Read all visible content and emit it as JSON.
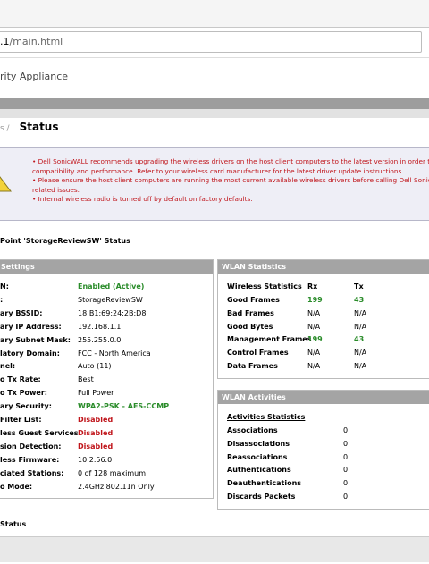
{
  "browser": {
    "url_prefix": ".1",
    "url_path": "/main.html"
  },
  "header": {
    "app_title": "rity Appliance"
  },
  "breadcrumb": {
    "prev": "s /",
    "current": "Status"
  },
  "warnings": [
    "• Dell SonicWALL recommends upgrading the wireless drivers on the host client computers to the latest version in order to",
    "compatibility and performance. Refer to your wireless card manufacturer for the latest driver update instructions.",
    "• Please ensure the host client computers are running the most current available wireless drivers before calling Dell SonicW",
    "related issues.",
    "• Internal wireless radio is turned off by default on factory defaults."
  ],
  "ap_status_title": "Point 'StorageReviewSW' Status",
  "settings": {
    "header": "Settings",
    "rows": [
      {
        "label": "N:",
        "value": "Enabled (Active)",
        "style": "green"
      },
      {
        "label": ":",
        "value": "StorageReviewSW",
        "style": ""
      },
      {
        "label": "ary BSSID:",
        "value": "18:B1:69:24:2B:D8",
        "style": ""
      },
      {
        "label": "ary IP Address:",
        "value": "192.168.1.1",
        "style": ""
      },
      {
        "label": "ary Subnet Mask:",
        "value": "255.255.0.0",
        "style": ""
      },
      {
        "label": "latory Domain:",
        "value": "FCC - North America",
        "style": ""
      },
      {
        "label": "nel:",
        "value": "Auto (11)",
        "style": ""
      },
      {
        "label": "o Tx Rate:",
        "value": "Best",
        "style": ""
      },
      {
        "label": "o Tx Power:",
        "value": "Full Power",
        "style": ""
      },
      {
        "label": "ary Security:",
        "value": "WPA2-PSK - AES-CCMP",
        "style": "green"
      },
      {
        "label": "Filter List:",
        "value": "Disabled",
        "style": "red"
      },
      {
        "label": "less Guest Services:",
        "value": "Disabled",
        "style": "red"
      },
      {
        "label": "sion Detection:",
        "value": "Disabled",
        "style": "red"
      },
      {
        "label": "less Firmware:",
        "value": "10.2.56.0",
        "style": ""
      },
      {
        "label": "ciated Stations:",
        "value": "0 of 128 maximum",
        "style": ""
      },
      {
        "label": "o Mode:",
        "value": "2.4GHz 802.11n Only",
        "style": ""
      }
    ]
  },
  "wlan_stats": {
    "header": "WLAN Statistics",
    "col_headers": [
      "Wireless Statistics",
      "Rx",
      "Tx"
    ],
    "rows": [
      {
        "name": "Good Frames",
        "rx": "199",
        "tx": "43",
        "highlight": true
      },
      {
        "name": "Bad Frames",
        "rx": "N/A",
        "tx": "N/A",
        "highlight": false
      },
      {
        "name": "Good Bytes",
        "rx": "N/A",
        "tx": "N/A",
        "highlight": false
      },
      {
        "name": "Management Frames",
        "rx": "199",
        "tx": "43",
        "highlight": true
      },
      {
        "name": "Control Frames",
        "rx": "N/A",
        "tx": "N/A",
        "highlight": false
      },
      {
        "name": "Data Frames",
        "rx": "N/A",
        "tx": "N/A",
        "highlight": false
      }
    ]
  },
  "wlan_activities": {
    "header": "WLAN Activities",
    "col_header": "Activities Statistics",
    "rows": [
      {
        "name": "Associations",
        "value": "0"
      },
      {
        "name": "Disassociations",
        "value": "0"
      },
      {
        "name": "Reassociations",
        "value": "0"
      },
      {
        "name": "Authentications",
        "value": "0"
      },
      {
        "name": "Deauthentications",
        "value": "0"
      },
      {
        "name": "Discards Packets",
        "value": "0"
      }
    ]
  },
  "footer_status": "Status"
}
